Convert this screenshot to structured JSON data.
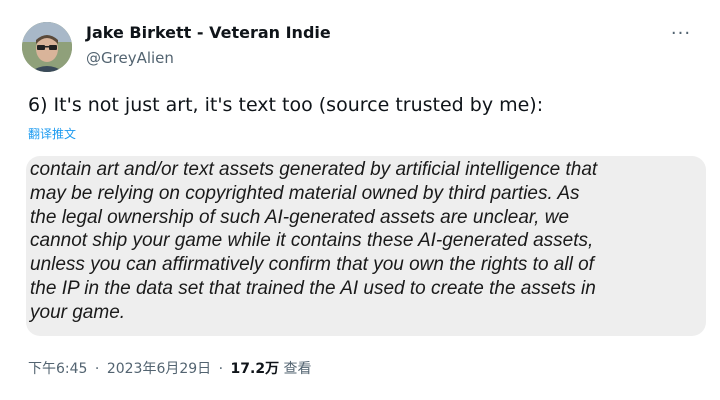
{
  "author": {
    "display_name": "Jake Birkett - Veteran Indie",
    "handle": "@GreyAlien"
  },
  "more_button": "···",
  "tweet": {
    "text": "6) It's not just art, it's text too (source trusted by me):",
    "translate_label": "翻译推文"
  },
  "media": {
    "lines": [
      "contain art and/or text assets generated by artificial intelligence that",
      "may be relying on copyrighted material owned by third parties. As",
      "the legal ownership of such AI-generated assets are unclear, we",
      "cannot ship your game while it contains these AI-generated assets,",
      "unless you can affirmatively confirm that you own the rights to all of",
      "the IP in the data set that trained the AI used to create the assets in",
      "your game."
    ]
  },
  "footer": {
    "time": "下午6:45",
    "date": "2023年6月29日",
    "views_count": "17.2万",
    "views_label": "查看",
    "separator": "·"
  },
  "colors": {
    "accent": "#1d9bf0",
    "secondary_text": "#536471",
    "media_background": "#eeeeee"
  }
}
